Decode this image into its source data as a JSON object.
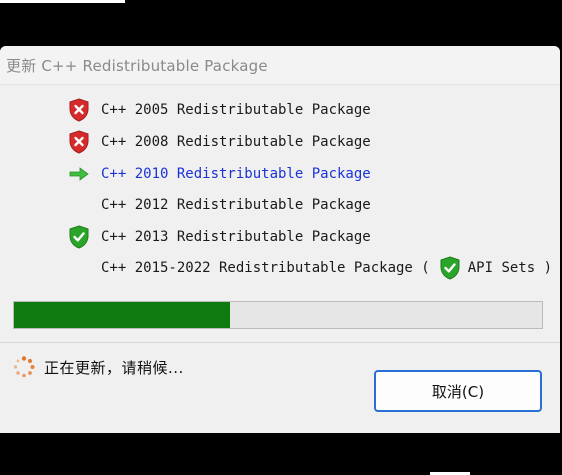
{
  "window": {
    "title": "更新 C++ Redistributable Package"
  },
  "packages": [
    {
      "label": "C++ 2005 Redistributable Package",
      "status": "error",
      "icon": "shield-error-icon"
    },
    {
      "label": "C++ 2008 Redistributable Package",
      "status": "error",
      "icon": "shield-error-icon"
    },
    {
      "label": "C++ 2010 Redistributable Package",
      "status": "in-progress",
      "icon": "arrow-right-icon"
    },
    {
      "label": "C++ 2012 Redistributable Package",
      "status": "pending",
      "icon": ""
    },
    {
      "label": "C++ 2013 Redistributable Package",
      "status": "success",
      "icon": "shield-check-icon"
    }
  ],
  "package_2015": {
    "label_prefix": "C++ 2015-2022 Redistributable Package (",
    "api_label": "API Sets )",
    "icon": "shield-check-icon"
  },
  "progress": {
    "fraction": 0.41
  },
  "status": {
    "text": "正在更新，请稍候...",
    "icon": "spinner-icon"
  },
  "buttons": {
    "cancel_label": "取消(C)"
  },
  "colors": {
    "progress_fill": "#0f7a0f",
    "current_item_text": "#1a33d6",
    "error_shield": "#d52b2b",
    "success_shield": "#2aa52a",
    "arrow": "#3fbf3f",
    "spinner": "#e0782a",
    "button_border": "#2a6fd6"
  }
}
